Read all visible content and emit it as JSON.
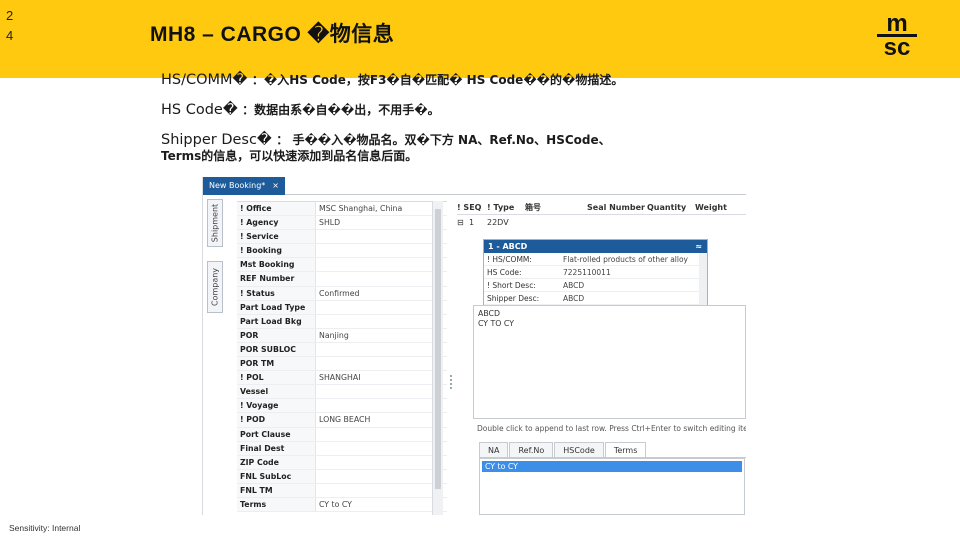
{
  "slide": {
    "page_number_line1": "2",
    "page_number_line2": "4",
    "title": "MH8 – CARGO �物信息",
    "logo_top": "m",
    "logo_bottom": "sc",
    "footer": "Sensitivity: Internal",
    "brand_color": "#fec90f"
  },
  "bullets": [
    {
      "label": "HS/COMM�",
      "text": "：�入HS Code，按F3�自�匹配� HS Code��的�物描述。",
      "cont": ""
    },
    {
      "label": "HS Code�",
      "text": "：数据由系�自��出，不用手�。",
      "cont": ""
    },
    {
      "label": "Shipper Desc�",
      "text": "： 手��入�物品名。双�下方 NA、Ref.No、HSCode、",
      "cont": "Terms的信息，可以快速添加到品名信息后面。"
    }
  ],
  "app": {
    "tab_label": "New Booking*",
    "tab_close": "×",
    "side_tabs": [
      "Shipment",
      "Company"
    ],
    "fields": [
      {
        "label": "! Office",
        "value": "MSC Shanghai, China"
      },
      {
        "label": "! Agency",
        "value": "SHLD"
      },
      {
        "label": "! Service",
        "value": ""
      },
      {
        "label": "! Booking",
        "value": ""
      },
      {
        "label": "Mst Booking",
        "value": ""
      },
      {
        "label": "REF Number",
        "value": ""
      },
      {
        "label": "! Status",
        "value": "Confirmed"
      },
      {
        "label": "Part Load Type",
        "value": ""
      },
      {
        "label": "Part Load Bkg",
        "value": ""
      },
      {
        "label": "POR",
        "value": "Nanjing"
      },
      {
        "label": "POR SUBLOC",
        "value": ""
      },
      {
        "label": "POR TM",
        "value": ""
      },
      {
        "label": "! POL",
        "value": "SHANGHAI"
      },
      {
        "label": "Vessel",
        "value": ""
      },
      {
        "label": "! Voyage",
        "value": ""
      },
      {
        "label": "! POD",
        "value": "LONG BEACH"
      },
      {
        "label": "Port Clause",
        "value": ""
      },
      {
        "label": "Final Dest",
        "value": ""
      },
      {
        "label": "ZIP Code",
        "value": ""
      },
      {
        "label": "FNL SubLoc",
        "value": ""
      },
      {
        "label": "FNL TM",
        "value": ""
      },
      {
        "label": "Terms",
        "value": "CY to CY"
      }
    ],
    "cargo_columns": [
      "! SEQ",
      "! Type",
      "箱号",
      "Seal Number",
      "Quantity",
      "Weight"
    ],
    "cargo_row": {
      "expander": "⊟",
      "seq": "1",
      "type": "22DV"
    },
    "detail": {
      "header": "1 - ABCD",
      "chevron": "≈",
      "rows": [
        {
          "label": "! HS/COMM:",
          "value": "Flat-rolled products of other alloy st..."
        },
        {
          "label": "HS Code:",
          "value": "7225110011"
        },
        {
          "label": "! Short Desc:",
          "value": "ABCD"
        },
        {
          "label": "Shipper Desc:",
          "value": "ABCD"
        }
      ]
    },
    "desc_lines": [
      "ABCD",
      "CY TO CY"
    ],
    "hint": "Double click to append to last row. Press Ctrl+Enter to switch editing itef...",
    "subtabs": [
      "NA",
      "Ref.No",
      "HSCode",
      "Terms"
    ],
    "subtab_active": "Terms",
    "subitems": [
      "CY to CY"
    ],
    "accent_color": "#1e5b9b",
    "selection_color": "#3d8ee6"
  }
}
